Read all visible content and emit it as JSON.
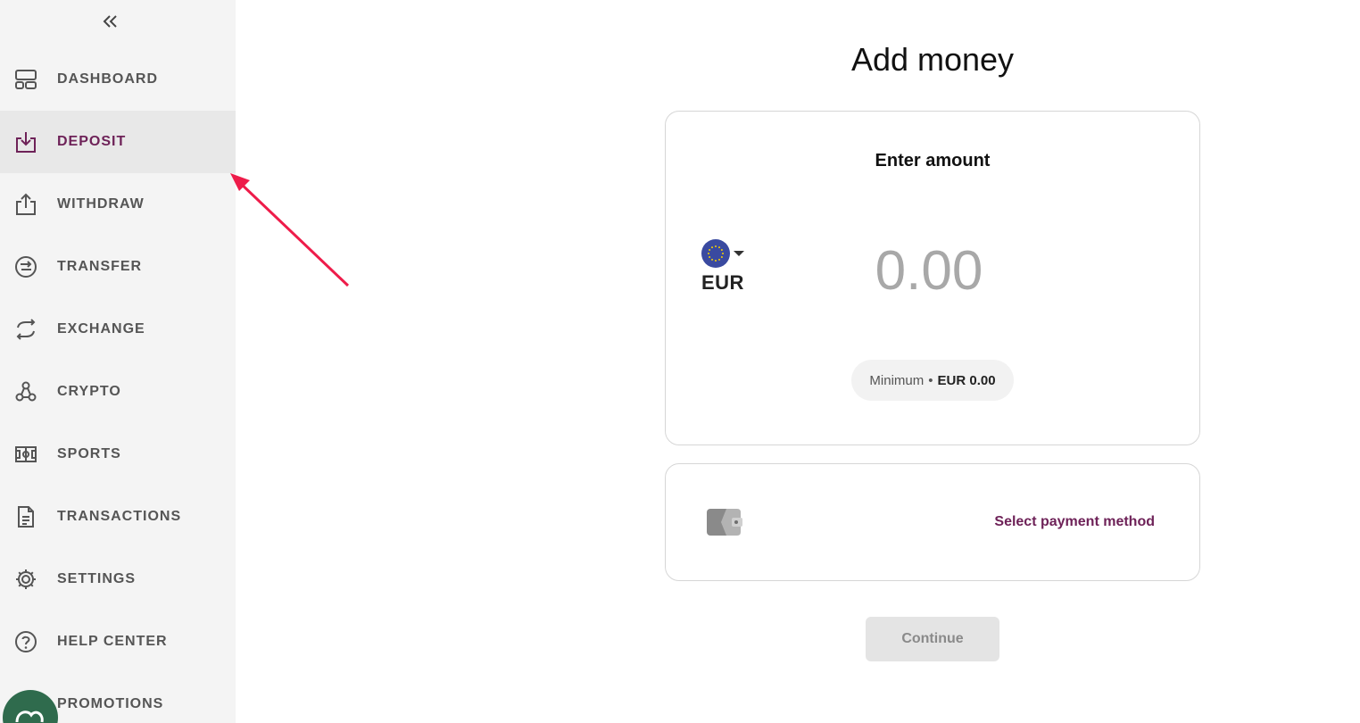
{
  "sidebar": {
    "collapse_icon": "double-chevron-left-icon",
    "items": [
      {
        "label": "DASHBOARD",
        "icon": "dashboard-icon",
        "active": false
      },
      {
        "label": "DEPOSIT",
        "icon": "deposit-icon",
        "active": true
      },
      {
        "label": "WITHDRAW",
        "icon": "withdraw-icon",
        "active": false
      },
      {
        "label": "TRANSFER",
        "icon": "transfer-icon",
        "active": false
      },
      {
        "label": "EXCHANGE",
        "icon": "exchange-icon",
        "active": false
      },
      {
        "label": "CRYPTO",
        "icon": "crypto-icon",
        "active": false
      },
      {
        "label": "SPORTS",
        "icon": "sports-icon",
        "active": false
      },
      {
        "label": "TRANSACTIONS",
        "icon": "transactions-icon",
        "active": false
      },
      {
        "label": "SETTINGS",
        "icon": "gear-icon",
        "active": false
      },
      {
        "label": "HELP CENTER",
        "icon": "help-icon",
        "active": false
      },
      {
        "label": "PROMOTIONS",
        "icon": "promotions-icon",
        "active": false
      }
    ]
  },
  "main": {
    "title": "Add money",
    "amount_card": {
      "heading": "Enter amount",
      "currency_code": "EUR",
      "amount_placeholder": "0.00",
      "minimum_label": "Minimum",
      "minimum_value": "EUR 0.00"
    },
    "payment_card": {
      "label": "Select payment method",
      "icon": "wallet-icon"
    },
    "continue_label": "Continue"
  },
  "colors": {
    "accent": "#6e2258",
    "sidebar_bg": "#f4f4f4",
    "active_bg": "#e8e8e8",
    "annotation_arrow": "#ee1c4a"
  }
}
